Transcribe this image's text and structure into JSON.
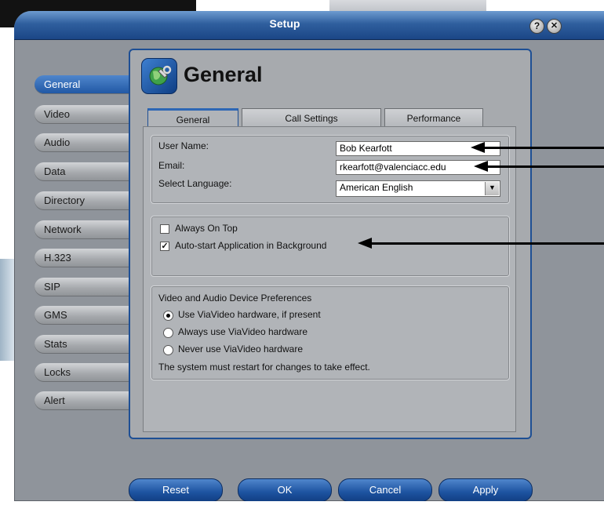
{
  "window": {
    "title": "Setup"
  },
  "titlebar": {
    "help_label": "?",
    "close_label": "✕"
  },
  "sidebar": {
    "items": [
      {
        "label": "General"
      },
      {
        "label": "Video"
      },
      {
        "label": "Audio"
      },
      {
        "label": "Data"
      },
      {
        "label": "Directory"
      },
      {
        "label": "Network"
      },
      {
        "label": "H.323"
      },
      {
        "label": "SIP"
      },
      {
        "label": "GMS"
      },
      {
        "label": "Stats"
      },
      {
        "label": "Locks"
      },
      {
        "label": "Alert"
      }
    ],
    "active": "General"
  },
  "header": {
    "title": "General",
    "icon": "wrench-globe-icon"
  },
  "tabs": [
    {
      "label": "General"
    },
    {
      "label": "Call Settings"
    },
    {
      "label": "Performance"
    }
  ],
  "user_info": {
    "user_name_label": "User Name:",
    "user_name_value": "Bob Kearfott",
    "email_label": "Email:",
    "email_value": "rkearfott@valenciacc.edu",
    "language_label": "Select Language:",
    "language_value": "American English"
  },
  "options": {
    "always_on_top_label": "Always On Top",
    "always_on_top_checked": false,
    "autostart_label": "Auto-start Application in Background",
    "autostart_checked": true
  },
  "device_prefs": {
    "title": "Video and Audio Device Preferences",
    "radios": [
      {
        "label": "Use ViaVideo hardware, if present",
        "selected": true
      },
      {
        "label": "Always use ViaVideo hardware",
        "selected": false
      },
      {
        "label": "Never use ViaVideo hardware",
        "selected": false
      }
    ],
    "note": "The system must restart for changes to take effect."
  },
  "buttons": {
    "reset": "Reset",
    "ok": "OK",
    "cancel": "Cancel",
    "apply": "Apply"
  },
  "colors": {
    "accent": "#1f56a3",
    "panel": "#a7aaae"
  }
}
